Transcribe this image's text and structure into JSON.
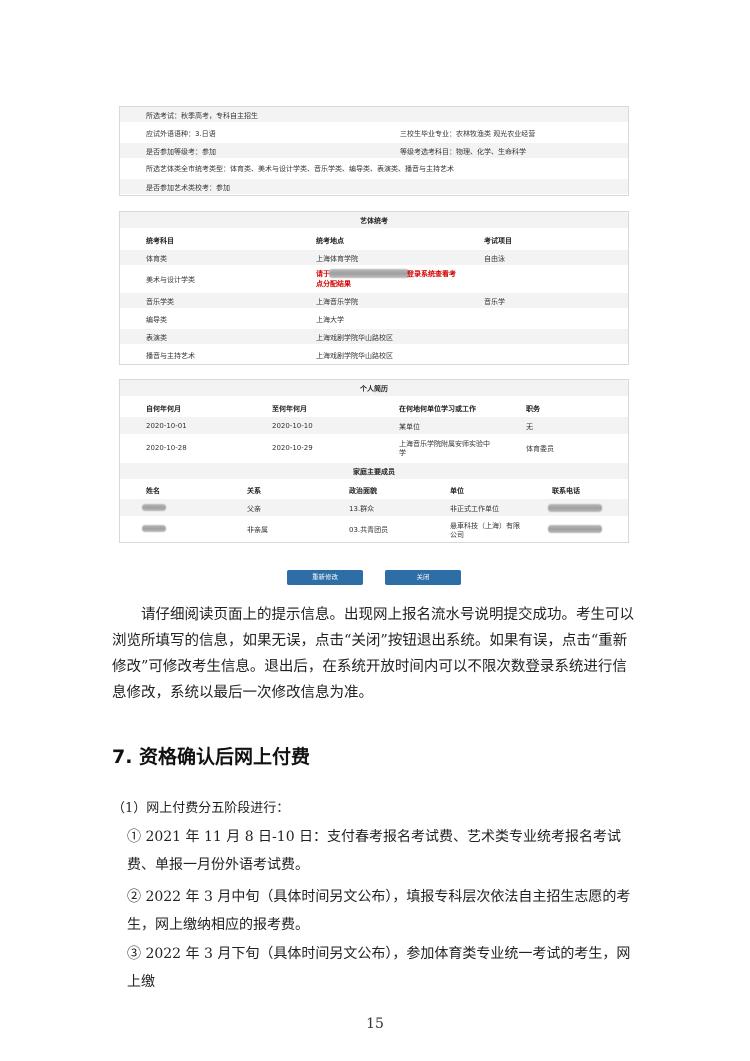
{
  "info_panel": {
    "exam_type": "所选考试：秋季高考，专科自主招生",
    "foreign_lang": "应试外语语种：3.日语",
    "vocational": "三校生毕业专业：农林牧渔类 观光农业经营",
    "grade_exam": "是否参加等级考：参加",
    "grade_subjects": "等级考选考科目：物理、化学、生命科学",
    "art_types": "所选艺体类全市统考类型：体育类、美术与设计学类、音乐学类、编导类、表演类、播音与主持艺术",
    "art_school": "是否参加艺术类校考：参加"
  },
  "art_panel": {
    "title": "艺体统考",
    "headers": [
      "统考科目",
      "统考地点",
      "考试项目"
    ],
    "rows": [
      {
        "subject": "体育类",
        "place": "上海体育学院",
        "item": "自由泳"
      },
      {
        "subject": "美术与设计学类",
        "place_red_1": "请于",
        "place_red_2": "登录系统查看考",
        "place_red_3": "点分配结果",
        "item": ""
      },
      {
        "subject": "音乐学类",
        "place": "上海音乐学院",
        "item": "音乐学"
      },
      {
        "subject": "编导类",
        "place": "上海大学",
        "item": ""
      },
      {
        "subject": "表演类",
        "place": "上海戏剧学院华山路校区",
        "item": ""
      },
      {
        "subject": "播音与主持艺术",
        "place": "上海戏剧学院华山路校区",
        "item": ""
      }
    ]
  },
  "resume_panel": {
    "title": "个人简历",
    "headers": [
      "自何年何月",
      "至何年何月",
      "在何地何单位学习或工作",
      "职务"
    ],
    "rows": [
      {
        "from": "2020-10-01",
        "to": "2020-10-10",
        "unit": "某单位",
        "unit2": "",
        "role": "无"
      },
      {
        "from": "2020-10-28",
        "to": "2020-10-29",
        "unit": "上海音乐学院附属安师实验中",
        "unit2": "学",
        "role": "体育委员"
      }
    ],
    "family_title": "家庭主要成员",
    "family_headers": [
      "姓名",
      "关系",
      "政治面貌",
      "单位",
      "联系电话"
    ],
    "family_rows": [
      {
        "relation": "父亲",
        "political": "13.群众",
        "unit": "非正式工作单位",
        "unit2": ""
      },
      {
        "relation": "非亲属",
        "political": "03.共青团员",
        "unit": "悬車科技（上海）有限",
        "unit2": "公司"
      }
    ]
  },
  "buttons": {
    "modify": "重新修改",
    "close": "关闭"
  },
  "paragraph": "请仔细阅读页面上的提示信息。出现网上报名流水号说明提交成功。考生可以浏览所填写的信息，如果无误，点击“关闭”按钮退出系统。如果有误，点击“重新修改”可修改考生信息。退出后，在系统开放时间内可以不限次数登录系统进行信息修改，系统以最后一次修改信息为准。",
  "heading": "7. 资格确认后网上付费",
  "sub": "（1）网上付费分五阶段进行：",
  "items": [
    "① 2021 年 11 月 8 日-10 日：支付春考报名考试费、艺术类专业统考报名考试费、单报一月份外语考试费。",
    "② 2022 年 3 月中旬（具体时间另文公布），填报专科层次依法自主招生志愿的考生，网上缴纳相应的报考费。",
    "③ 2022 年 3 月下旬（具体时间另文公布），参加体育类专业统一考试的考生，网上缴"
  ],
  "page_number": "15"
}
